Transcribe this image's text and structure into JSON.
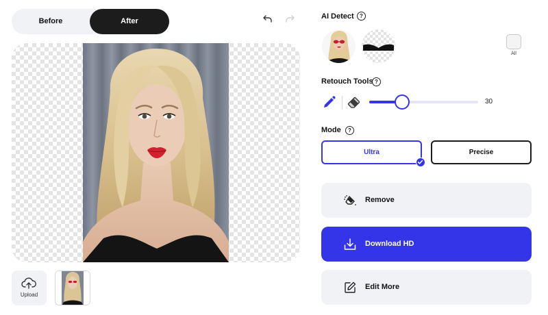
{
  "toggle": {
    "before_label": "Before",
    "after_label": "After",
    "selected": "After"
  },
  "history": {
    "undo_icon": "undo-icon",
    "redo_icon": "redo-icon",
    "redo_enabled": false
  },
  "ai_detect": {
    "title": "AI Detect",
    "help": "?",
    "all_label": "All"
  },
  "retouch": {
    "title": "Retouch Tools",
    "help": "?",
    "brush_size": 30,
    "brush_size_max": 100,
    "active_tool": "brush"
  },
  "mode": {
    "title": "Mode",
    "help": "?",
    "options": [
      "Ultra",
      "Precise"
    ],
    "selected": "Ultra"
  },
  "actions": {
    "remove_label": "Remove",
    "download_label": "Download HD",
    "edit_label": "Edit More"
  },
  "upload": {
    "label": "Upload"
  },
  "colors": {
    "accent": "#3434e8",
    "dark": "#1c1c1c",
    "panel": "#f1f2f5",
    "lip_red": "#d41f2e"
  }
}
